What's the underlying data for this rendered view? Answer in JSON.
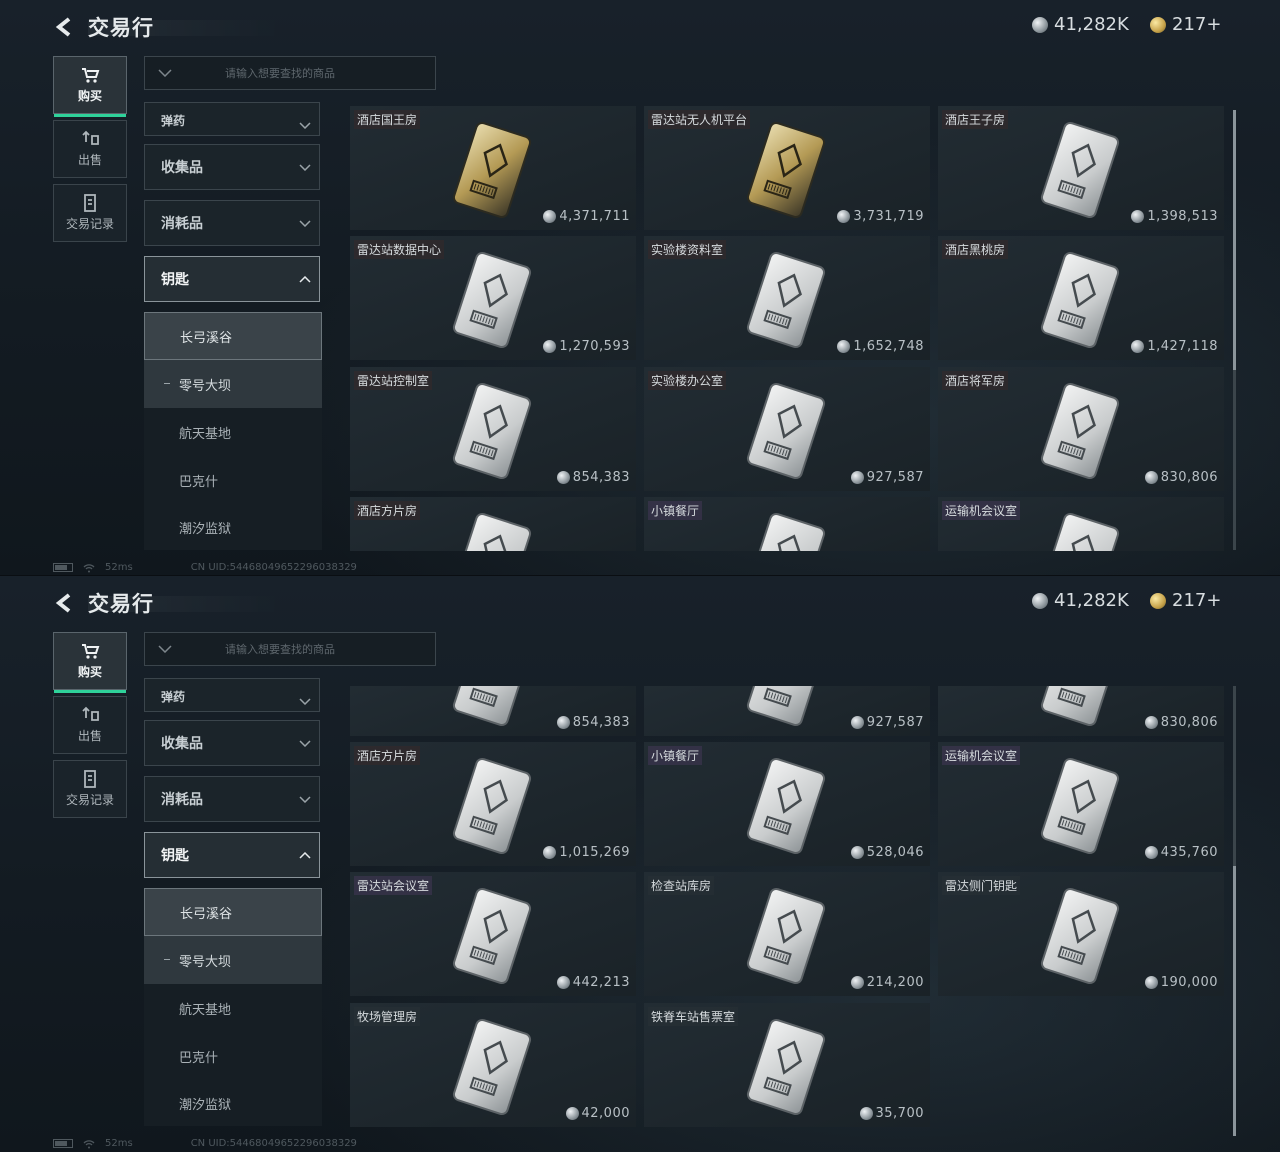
{
  "header": {
    "title": "交易行",
    "silver_balance": "41,282K",
    "gold_balance": "217+"
  },
  "rail": {
    "buy": "购买",
    "sell": "出售",
    "history": "交易记录"
  },
  "search": {
    "placeholder": "请输入想要查找的商品"
  },
  "categories": {
    "contract": "弹药",
    "collectibles": "收集品",
    "consumables": "消耗品",
    "keys": "钥匙"
  },
  "subcategories": [
    "长弓溪谷",
    "零号大坝",
    "航天基地",
    "巴克什",
    "潮汐监狱"
  ],
  "footer": {
    "ping": "52ms",
    "uid": "CN UID:5446804965229603832​9"
  },
  "screen1": {
    "items": [
      {
        "name": "酒店国王房",
        "price": "4,371,711",
        "gold": true,
        "tag": "red"
      },
      {
        "name": "雷达站无人机平台",
        "price": "3,731,719",
        "gold": true,
        "tag": "red"
      },
      {
        "name": "酒店王子房",
        "price": "1,398,513",
        "gold": false,
        "tag": "red"
      },
      {
        "name": "雷达站数据中心",
        "price": "1,270,593",
        "gold": false,
        "tag": "red"
      },
      {
        "name": "实验楼资料室",
        "price": "1,652,748",
        "gold": false,
        "tag": "red"
      },
      {
        "name": "酒店黑桃房",
        "price": "1,427,118",
        "gold": false,
        "tag": "red"
      },
      {
        "name": "雷达站控制室",
        "price": "854,383",
        "gold": false,
        "tag": "red"
      },
      {
        "name": "实验楼办公室",
        "price": "927,587",
        "gold": false,
        "tag": "red"
      },
      {
        "name": "酒店将军房",
        "price": "830,806",
        "gold": false,
        "tag": "red"
      },
      {
        "name": "酒店方片房",
        "price": "",
        "gold": false,
        "tag": "red"
      },
      {
        "name": "小镇餐厅",
        "price": "",
        "gold": false,
        "tag": "purple"
      },
      {
        "name": "运输机会议室",
        "price": "",
        "gold": false,
        "tag": "purple"
      }
    ]
  },
  "screen2": {
    "items": [
      {
        "name": "",
        "price": "854,383",
        "gold": false,
        "tag": "none"
      },
      {
        "name": "",
        "price": "927,587",
        "gold": false,
        "tag": "none"
      },
      {
        "name": "",
        "price": "830,806",
        "gold": false,
        "tag": "none"
      },
      {
        "name": "酒店方片房",
        "price": "1,015,269",
        "gold": false,
        "tag": "red"
      },
      {
        "name": "小镇餐厅",
        "price": "528,046",
        "gold": false,
        "tag": "purple"
      },
      {
        "name": "运输机会议室",
        "price": "435,760",
        "gold": false,
        "tag": "purple"
      },
      {
        "name": "雷达站会议室",
        "price": "442,213",
        "gold": false,
        "tag": "purple"
      },
      {
        "name": "检查站库房",
        "price": "214,200",
        "gold": false,
        "tag": "plain"
      },
      {
        "name": "雷达侧门钥匙",
        "price": "190,000",
        "gold": false,
        "tag": "plain"
      },
      {
        "name": "牧场管理房",
        "price": "42,000",
        "gold": false,
        "tag": "plain"
      },
      {
        "name": "铁脊车站售票室",
        "price": "35,700",
        "gold": false,
        "tag": "plain"
      }
    ]
  },
  "colors": {
    "accent": "#2fd29a",
    "panel": "#1b242a",
    "border": "#3b454c"
  }
}
